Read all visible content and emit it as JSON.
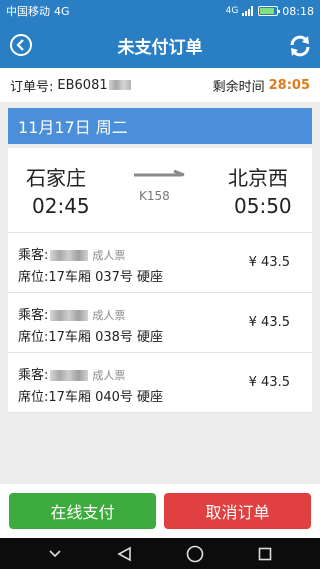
{
  "status_bar": {
    "carrier": "中国移动",
    "network": "4G",
    "signal_badge": "4G",
    "time": "08:18"
  },
  "nav": {
    "title": "未支付订单"
  },
  "order": {
    "label": "订单号:",
    "number_visible": "EB6081",
    "remaining_label": "剩余时间",
    "countdown": "28:05"
  },
  "date": "11月17日 周二",
  "trip": {
    "from_station": "石家庄",
    "depart_time": "02:45",
    "train_no": "K158",
    "to_station": "北京西",
    "arrive_time": "05:50"
  },
  "passengers": [
    {
      "label": "乘客:",
      "ticket_type": "成人票",
      "seat_label": "席位:",
      "seat": "17车厢 037号 硬座",
      "price": "¥ 43.5"
    },
    {
      "label": "乘客:",
      "ticket_type": "成人票",
      "seat_label": "席位:",
      "seat": "17车厢 038号 硬座",
      "price": "¥ 43.5"
    },
    {
      "label": "乘客:",
      "ticket_type": "成人票",
      "seat_label": "席位:",
      "seat": "17车厢 040号 硬座",
      "price": "¥ 43.5"
    }
  ],
  "actions": {
    "pay_label": "在线支付",
    "cancel_label": "取消订单"
  },
  "colors": {
    "header": "#2a7fc4",
    "date_bar": "#4a8fd8",
    "countdown": "#e07a1e",
    "pay_button": "#3eab3e",
    "cancel_button": "#e04040"
  },
  "icons": {
    "back": "back-arrow-circle-icon",
    "refresh": "refresh-icon",
    "route": "right-arrow-icon",
    "sys_down": "chevron-down-icon",
    "sys_back": "triangle-back-icon",
    "sys_home": "circle-home-icon",
    "sys_recent": "square-recent-icon"
  }
}
